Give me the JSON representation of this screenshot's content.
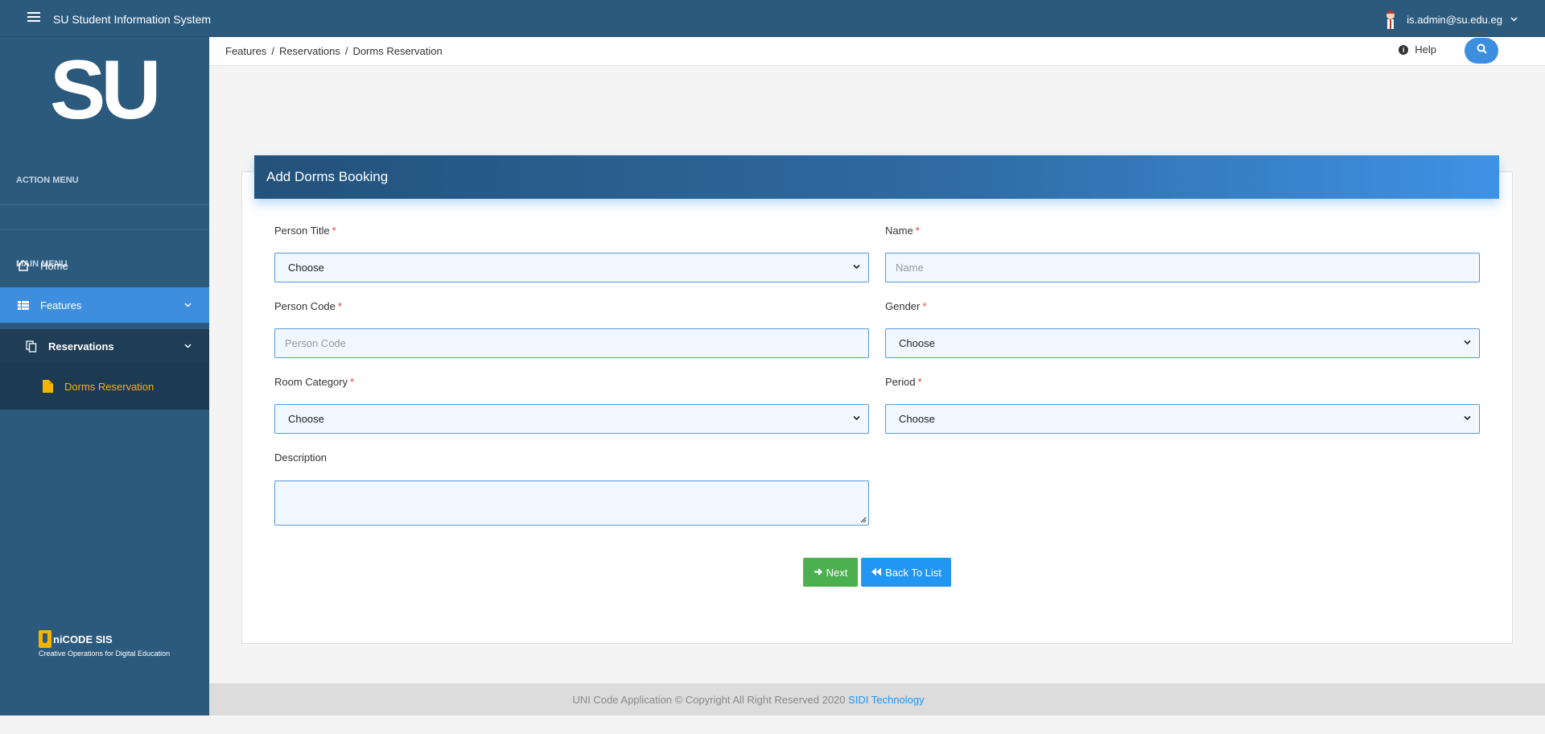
{
  "topbar": {
    "app_title": "SU Student Information System",
    "user_email": "is.admin@su.edu.eg"
  },
  "sidebar": {
    "logo_text": "SU",
    "action_menu_label": "ACTION MENU",
    "main_menu_label": "MAIN MENU",
    "items": [
      {
        "label": "Home"
      },
      {
        "label": "Features"
      },
      {
        "label": "Reservations"
      },
      {
        "label": "Dorms Reservation"
      }
    ],
    "brand_title": "niCODE SIS",
    "brand_subtitle": "Creative Operations for Digital Education"
  },
  "breadcrumb": {
    "items": [
      "Features",
      "Reservations",
      "Dorms Reservation"
    ],
    "separator": "/"
  },
  "header": {
    "help_label": "Help"
  },
  "form": {
    "title": "Add Dorms Booking",
    "required_mark": "*",
    "person_title": {
      "label": "Person Title",
      "value": "Choose"
    },
    "name": {
      "label": "Name",
      "placeholder": "Name"
    },
    "person_code": {
      "label": "Person Code",
      "placeholder": "Person Code"
    },
    "gender": {
      "label": "Gender",
      "value": "Choose"
    },
    "room_category": {
      "label": "Room Category",
      "value": "Choose"
    },
    "period": {
      "label": "Period",
      "value": "Choose"
    },
    "description": {
      "label": "Description"
    },
    "next_label": "Next",
    "back_label": "Back To List"
  },
  "footer": {
    "text": "UNI Code Application © Copyright All Right Reserved 2020",
    "link": "SIDI Technology"
  },
  "colors": {
    "sidebar": "#2c5a7d",
    "active_item": "#3e8ee0",
    "active_sub_item_text": "#f4b400",
    "next_button": "#4caf50",
    "back_button": "#2196f3"
  }
}
